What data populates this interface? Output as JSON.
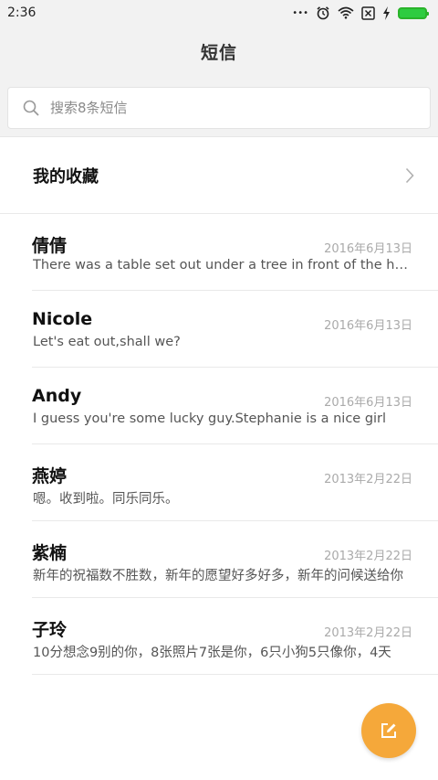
{
  "status": {
    "time": "2:36",
    "dots": "•••"
  },
  "header": {
    "title": "短信"
  },
  "search": {
    "placeholder": "搜索8条短信"
  },
  "favorites": {
    "label": "我的收藏"
  },
  "messages": [
    {
      "name": "倩倩",
      "date": "2016年6月13日",
      "preview": "There was a table set out under a tree in front of the house"
    },
    {
      "name": "Nicole",
      "date": "2016年6月13日",
      "preview": "Let's eat out,shall we?"
    },
    {
      "name": "Andy",
      "date": "2016年6月13日",
      "preview": "I guess you're some lucky guy.Stephanie is a nice girl"
    },
    {
      "name": "燕婷",
      "date": "2013年2月22日",
      "preview": "嗯。收到啦。同乐同乐。"
    },
    {
      "name": "紫楠",
      "date": "2013年2月22日",
      "preview": "新年的祝福数不胜数，新年的愿望好多好多，新年的问候送给你"
    },
    {
      "name": "子玲",
      "date": "2013年2月22日",
      "preview": "10分想念9别的你，8张照片7张是你，6只小狗5只像你，4天"
    }
  ],
  "colors": {
    "accent": "#f5a83a",
    "battery": "#2ecc40"
  },
  "icons": {
    "search": "search-icon",
    "chevron": "chevron-right-icon",
    "compose": "compose-icon"
  }
}
